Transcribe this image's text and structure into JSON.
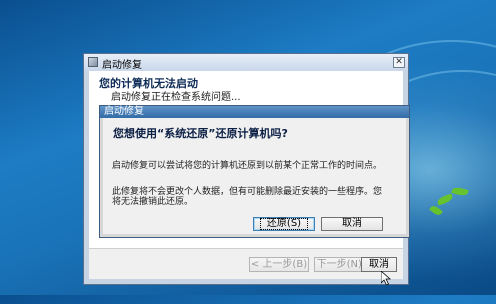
{
  "outer_window": {
    "title": "启动修复",
    "close_label": "✕",
    "heading": "您的计算机无法启动",
    "status": "启动修复正在检查系统问题...",
    "buttons": {
      "back": "< 上一步(B)",
      "next": "下一步(N) >",
      "cancel": "取消"
    }
  },
  "dialog": {
    "title": "启动修复",
    "question": "您想使用“系统还原”还原计算机吗?",
    "description": "启动修复可以尝试将您的计算机还原到以前某个正常工作的时间点。",
    "note": "此修复将不会更改个人数据，但有可能删除最近安装的一些程序。您将无法撤销此还原。",
    "buttons": {
      "restore": "还原(S)",
      "cancel": "取消"
    }
  },
  "icons": {
    "window_icon": "startup-repair-icon",
    "cursor": "arrow-cursor-icon"
  },
  "colors": {
    "desktop": "#1a73b8",
    "dialog_title": "#326ba6",
    "heading_text": "#0e2b57"
  }
}
